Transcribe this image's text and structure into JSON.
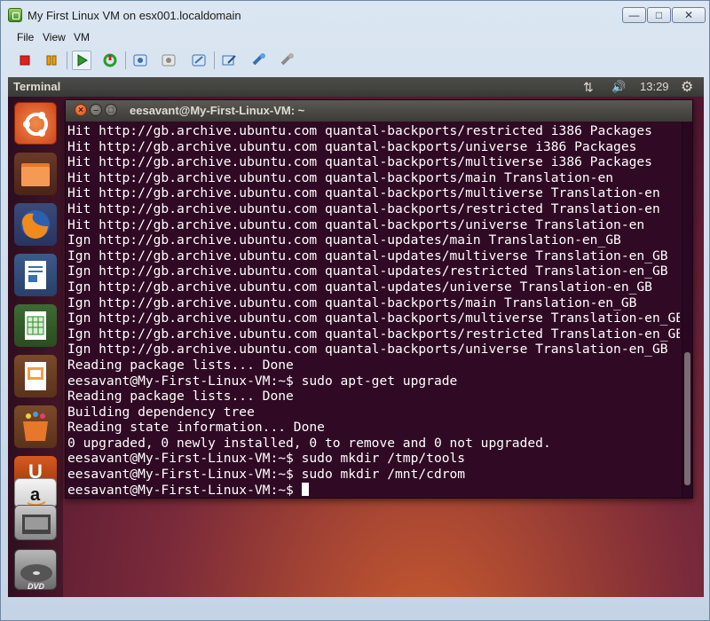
{
  "window": {
    "title": "My First Linux VM on esx001.localdomain",
    "min_glyph": "—",
    "max_glyph": "□",
    "close_glyph": "✕"
  },
  "menu": [
    "File",
    "View",
    "VM"
  ],
  "toolbar": {
    "icons": [
      {
        "name": "power-off-icon",
        "color": "#e02020"
      },
      {
        "name": "suspend-icon",
        "color": "#f0a000"
      },
      {
        "name": "power-on-icon",
        "color": "#2a9d2a"
      },
      {
        "name": "reset-icon",
        "color": "#2a9d2a"
      },
      {
        "name": "snapshot-icon",
        "color": "#3a6fb0"
      },
      {
        "name": "revert-snapshot-icon",
        "color": "#8a8a8a"
      },
      {
        "name": "snapshot-manager-icon",
        "color": "#3a6fb0"
      },
      {
        "name": "edit-settings-icon",
        "color": "#3a6fb0"
      },
      {
        "name": "connect-device-icon",
        "color": "#3a6fb0"
      },
      {
        "name": "disconnect-device-icon",
        "color": "#8a8a8a"
      }
    ]
  },
  "guest": {
    "panel": {
      "title": "Terminal",
      "net_glyph": "⇅",
      "vol_glyph": "🔊",
      "clock": "13:29",
      "gear_glyph": "⚙"
    },
    "launcher": [
      {
        "name": "ubuntu-dash-icon"
      },
      {
        "name": "files-icon"
      },
      {
        "name": "firefox-icon"
      },
      {
        "name": "writer-icon"
      },
      {
        "name": "calc-icon"
      },
      {
        "name": "impress-icon"
      },
      {
        "name": "software-center-icon"
      },
      {
        "name": "ubuntu-one-icon"
      },
      {
        "name": "amazon-icon"
      },
      {
        "name": "stacked-apps-icon"
      },
      {
        "name": "dvd-icon"
      }
    ],
    "terminal": {
      "title": "eesavant@My-First-Linux-VM: ~",
      "lines": [
        "Hit http://gb.archive.ubuntu.com quantal-backports/restricted i386 Packages",
        "Hit http://gb.archive.ubuntu.com quantal-backports/universe i386 Packages",
        "Hit http://gb.archive.ubuntu.com quantal-backports/multiverse i386 Packages",
        "Hit http://gb.archive.ubuntu.com quantal-backports/main Translation-en",
        "Hit http://gb.archive.ubuntu.com quantal-backports/multiverse Translation-en",
        "Hit http://gb.archive.ubuntu.com quantal-backports/restricted Translation-en",
        "Hit http://gb.archive.ubuntu.com quantal-backports/universe Translation-en",
        "Ign http://gb.archive.ubuntu.com quantal-updates/main Translation-en_GB",
        "Ign http://gb.archive.ubuntu.com quantal-updates/multiverse Translation-en_GB",
        "Ign http://gb.archive.ubuntu.com quantal-updates/restricted Translation-en_GB",
        "Ign http://gb.archive.ubuntu.com quantal-updates/universe Translation-en_GB",
        "Ign http://gb.archive.ubuntu.com quantal-backports/main Translation-en_GB",
        "Ign http://gb.archive.ubuntu.com quantal-backports/multiverse Translation-en_GB",
        "Ign http://gb.archive.ubuntu.com quantal-backports/restricted Translation-en_GB",
        "Ign http://gb.archive.ubuntu.com quantal-backports/universe Translation-en_GB",
        "Reading package lists... Done",
        "eesavant@My-First-Linux-VM:~$ sudo apt-get upgrade",
        "Reading package lists... Done",
        "Building dependency tree",
        "Reading state information... Done",
        "0 upgraded, 0 newly installed, 0 to remove and 0 not upgraded.",
        "eesavant@My-First-Linux-VM:~$ sudo mkdir /tmp/tools",
        "eesavant@My-First-Linux-VM:~$ sudo mkdir /mnt/cdrom",
        "eesavant@My-First-Linux-VM:~$ "
      ]
    }
  }
}
